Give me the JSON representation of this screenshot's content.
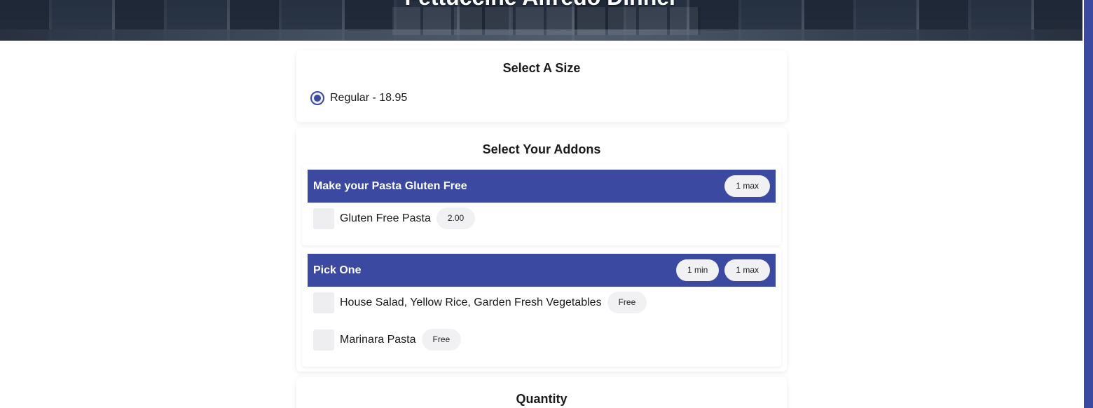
{
  "hero": {
    "title": "Fettuccine Alfredo Dinner"
  },
  "size_section": {
    "title": "Select A Size",
    "options": [
      {
        "label": "Regular - 18.95",
        "selected": true
      }
    ]
  },
  "addons_section": {
    "title": "Select Your Addons",
    "groups": [
      {
        "title": "Make your Pasta Gluten Free",
        "badges": [
          "1 max"
        ],
        "options": [
          {
            "label": "Gluten Free Pasta",
            "price": "2.00",
            "checked": false
          }
        ]
      },
      {
        "title": "Pick One",
        "badges": [
          "1 min",
          "1 max"
        ],
        "options": [
          {
            "label": "House Salad, Yellow Rice, Garden Fresh Vegetables",
            "price": "Free",
            "checked": false
          },
          {
            "label": "Marinara Pasta",
            "price": "Free",
            "checked": false
          }
        ]
      }
    ]
  },
  "quantity_section": {
    "title": "Quantity"
  },
  "colors": {
    "accent": "#3b4aa0",
    "pill_bg": "#f1f1f4",
    "checkbox_bg": "#eeeef1"
  }
}
